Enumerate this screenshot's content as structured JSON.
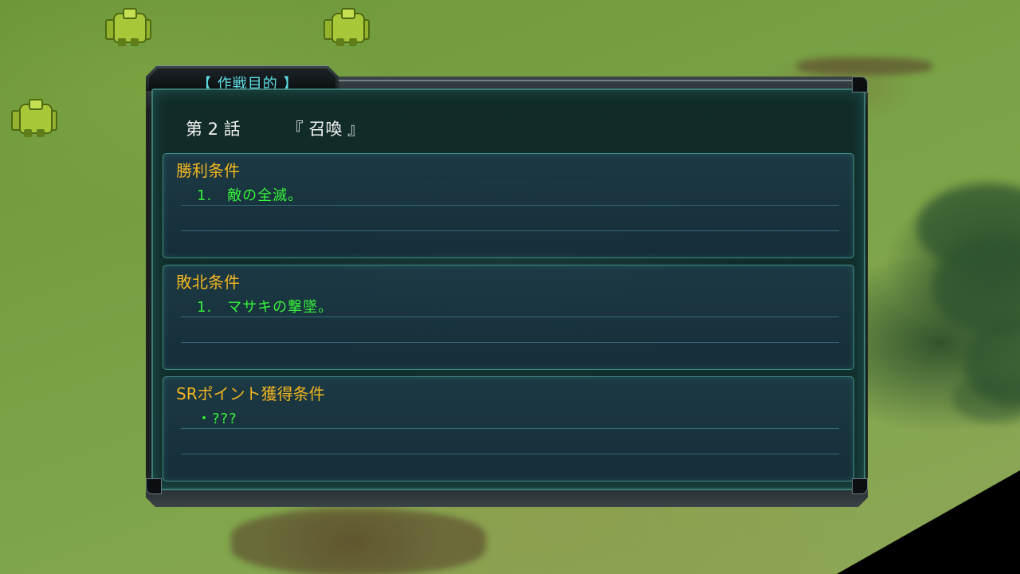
{
  "window": {
    "title": "【 作戦目的 】"
  },
  "stage": {
    "number": "第 2 話",
    "subtitle": "『 召喚 』"
  },
  "sections": [
    {
      "heading": "勝利条件",
      "item": "1.　敵の全滅。"
    },
    {
      "heading": "敗北条件",
      "item": "1.　マサキの撃墜。"
    },
    {
      "heading": "SRポイント獲得条件",
      "item": "・???"
    }
  ],
  "colors": {
    "title_cyan": "#5ee0e6",
    "heading_gold": "#f2b520",
    "item_green": "#35f23a",
    "panel_teal": "#1c3a46"
  },
  "icons": {
    "units": [
      "mech-unit-icon",
      "mech-unit-icon",
      "mech-unit-icon"
    ]
  }
}
